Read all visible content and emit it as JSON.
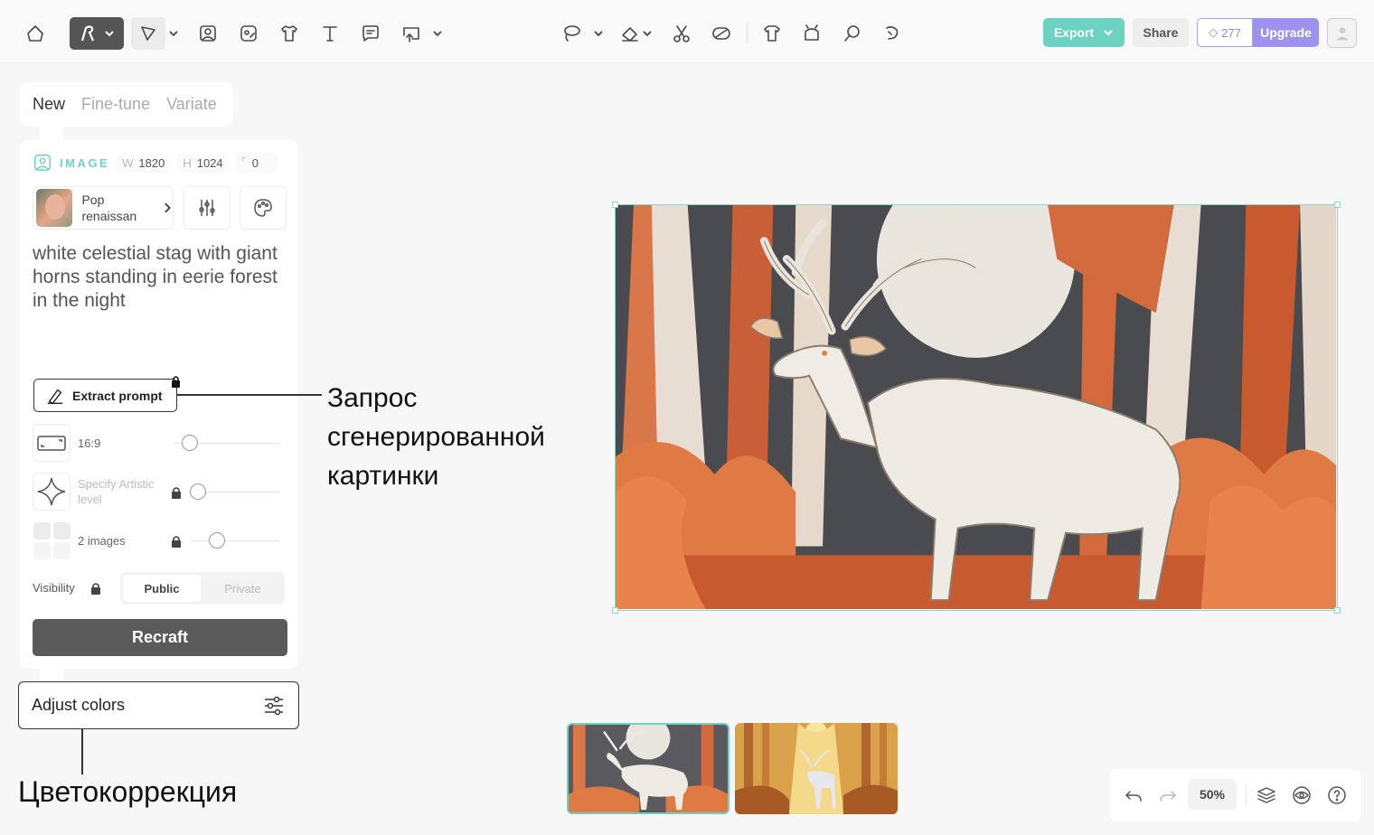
{
  "toolbar": {
    "export_label": "Export",
    "share_label": "Share",
    "credits": "277",
    "upgrade_label": "Upgrade"
  },
  "tabs": [
    {
      "label": "New",
      "active": true
    },
    {
      "label": "Fine-tune",
      "active": false
    },
    {
      "label": "Variate",
      "active": false
    }
  ],
  "panel": {
    "image_label": "IMAGE",
    "width_key": "W",
    "width_value": "1820",
    "height_key": "H",
    "height_value": "1024",
    "radius_value": "0",
    "style_name": "Pop renaissan",
    "prompt": "white celestial stag with giant horns standing in eerie forest in the night",
    "extract_label": "Extract prompt",
    "aspect_label": "16:9",
    "aspect_level": 0.15,
    "artistic_label": "Specify Artistic level",
    "artistic_level": 0.0,
    "images_label": "2 images",
    "images_level": 0.3,
    "visibility_label": "Visibility",
    "public_label": "Public",
    "private_label": "Private",
    "recraft_label": "Recraft",
    "adjust_label": "Adjust colors"
  },
  "annotations": {
    "prompt_note": "Запрос\nсгенерированной\nкартинки",
    "color_note": "Цветокоррекция"
  },
  "controls": {
    "zoom": "50%"
  },
  "colors": {
    "accent": "#6cd3c2",
    "upgrade": "#9d93ef",
    "dark_button": "#5a5a5a"
  }
}
